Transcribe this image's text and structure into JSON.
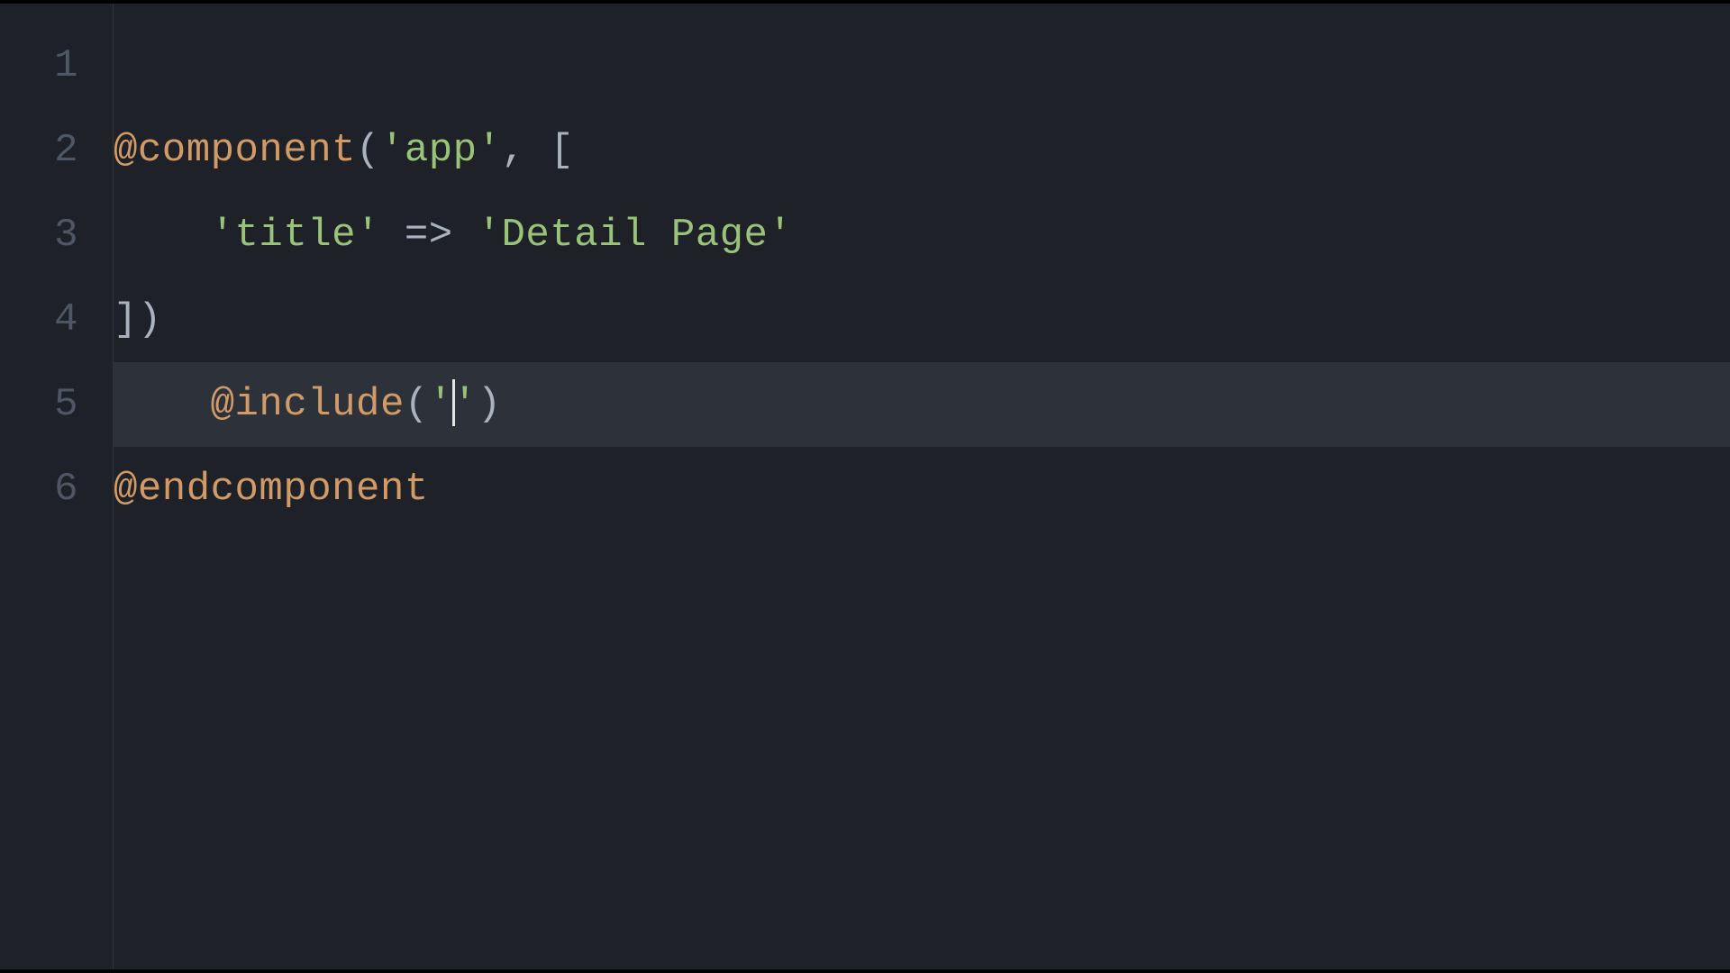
{
  "editor": {
    "active_line_index": 4,
    "lines": [
      {
        "number": "1",
        "raw": "",
        "tokens": []
      },
      {
        "number": "2",
        "raw": "@component('app', [",
        "tokens": [
          {
            "t": "@component",
            "c": "directive"
          },
          {
            "t": "(",
            "c": "punct"
          },
          {
            "t": "'app'",
            "c": "string"
          },
          {
            "t": ", ",
            "c": "default"
          },
          {
            "t": "[",
            "c": "punct"
          }
        ]
      },
      {
        "number": "3",
        "raw": "    'title' => 'Detail Page'",
        "tokens": [
          {
            "t": "    ",
            "c": "default"
          },
          {
            "t": "'title'",
            "c": "string"
          },
          {
            "t": " ",
            "c": "default"
          },
          {
            "t": "=>",
            "c": "operator"
          },
          {
            "t": " ",
            "c": "default"
          },
          {
            "t": "'Detail Page'",
            "c": "string"
          }
        ]
      },
      {
        "number": "4",
        "raw": "])",
        "tokens": [
          {
            "t": "]",
            "c": "punct"
          },
          {
            "t": ")",
            "c": "punct"
          }
        ]
      },
      {
        "number": "5",
        "raw": "    @include('')",
        "tokens": [
          {
            "t": "    ",
            "c": "default"
          },
          {
            "t": "@include",
            "c": "directive"
          },
          {
            "t": "(",
            "c": "punct"
          },
          {
            "t": "'",
            "c": "string"
          },
          {
            "cursor": true
          },
          {
            "t": "'",
            "c": "string"
          },
          {
            "t": ")",
            "c": "punct"
          }
        ]
      },
      {
        "number": "6",
        "raw": "@endcomponent",
        "tokens": [
          {
            "t": "@endcomponent",
            "c": "directive"
          }
        ]
      }
    ]
  }
}
